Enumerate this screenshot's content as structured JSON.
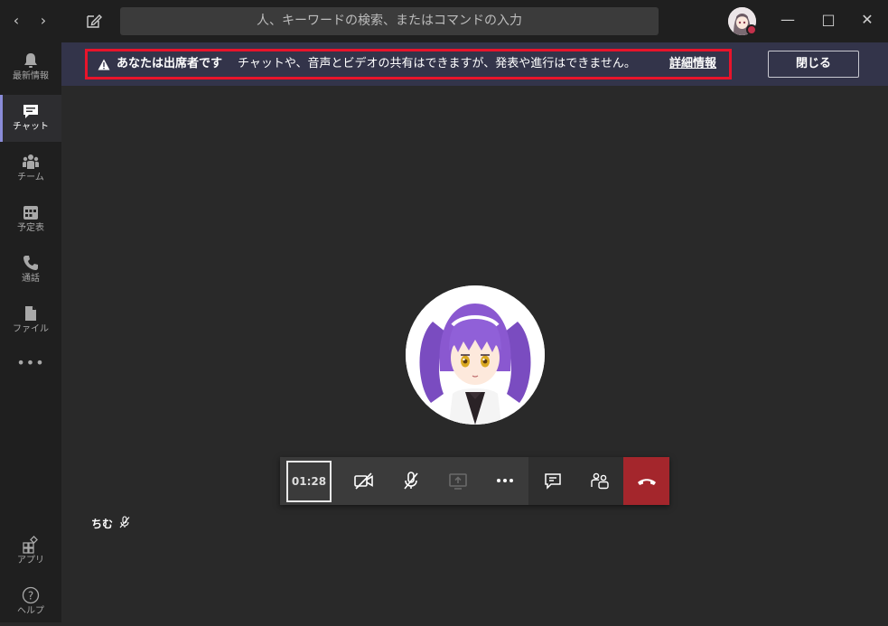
{
  "titlebar": {
    "back_icon": "chevron-left-icon",
    "forward_icon": "chevron-right-icon",
    "compose_icon": "compose-icon",
    "search_placeholder": "人、キーワードの検索、またはコマンドの入力"
  },
  "rail": {
    "items": [
      {
        "label": "最新情報",
        "icon": "bell-icon"
      },
      {
        "label": "チャット",
        "icon": "chat-icon",
        "active": true
      },
      {
        "label": "チーム",
        "icon": "teams-icon"
      },
      {
        "label": "予定表",
        "icon": "calendar-icon"
      },
      {
        "label": "通話",
        "icon": "phone-icon"
      },
      {
        "label": "ファイル",
        "icon": "file-icon"
      },
      {
        "label": "•••",
        "icon": "more-icon"
      }
    ],
    "bottom": [
      {
        "label": "アプリ",
        "icon": "apps-icon"
      },
      {
        "label": "ヘルプ",
        "icon": "help-icon"
      }
    ]
  },
  "banner": {
    "bold": "あなたは出席者です",
    "text": "チャットや、音声とビデオの共有はできますが、発表や進行はできません。",
    "link": "詳細情報",
    "close": "閉じる"
  },
  "call": {
    "timer": "01:28",
    "participant_name": "ちむ"
  },
  "colors": {
    "banner_bg": "#33344a",
    "highlight_border": "#e8142b",
    "hangup": "#a4262c",
    "accent": "#8a8cd8"
  }
}
